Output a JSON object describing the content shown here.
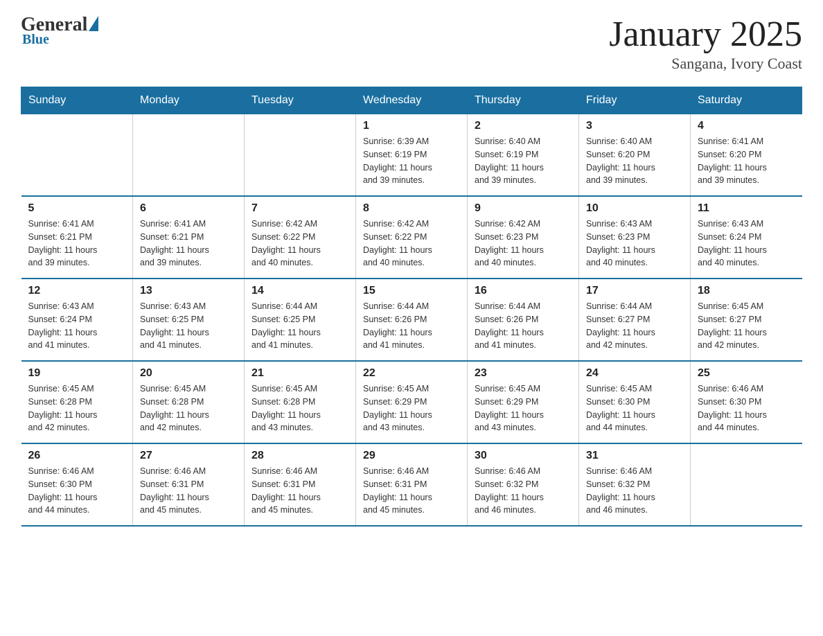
{
  "logo": {
    "general": "General",
    "blue": "Blue"
  },
  "title": "January 2025",
  "location": "Sangana, Ivory Coast",
  "days_header": [
    "Sunday",
    "Monday",
    "Tuesday",
    "Wednesday",
    "Thursday",
    "Friday",
    "Saturday"
  ],
  "weeks": [
    [
      {
        "day": "",
        "info": ""
      },
      {
        "day": "",
        "info": ""
      },
      {
        "day": "",
        "info": ""
      },
      {
        "day": "1",
        "info": "Sunrise: 6:39 AM\nSunset: 6:19 PM\nDaylight: 11 hours\nand 39 minutes."
      },
      {
        "day": "2",
        "info": "Sunrise: 6:40 AM\nSunset: 6:19 PM\nDaylight: 11 hours\nand 39 minutes."
      },
      {
        "day": "3",
        "info": "Sunrise: 6:40 AM\nSunset: 6:20 PM\nDaylight: 11 hours\nand 39 minutes."
      },
      {
        "day": "4",
        "info": "Sunrise: 6:41 AM\nSunset: 6:20 PM\nDaylight: 11 hours\nand 39 minutes."
      }
    ],
    [
      {
        "day": "5",
        "info": "Sunrise: 6:41 AM\nSunset: 6:21 PM\nDaylight: 11 hours\nand 39 minutes."
      },
      {
        "day": "6",
        "info": "Sunrise: 6:41 AM\nSunset: 6:21 PM\nDaylight: 11 hours\nand 39 minutes."
      },
      {
        "day": "7",
        "info": "Sunrise: 6:42 AM\nSunset: 6:22 PM\nDaylight: 11 hours\nand 40 minutes."
      },
      {
        "day": "8",
        "info": "Sunrise: 6:42 AM\nSunset: 6:22 PM\nDaylight: 11 hours\nand 40 minutes."
      },
      {
        "day": "9",
        "info": "Sunrise: 6:42 AM\nSunset: 6:23 PM\nDaylight: 11 hours\nand 40 minutes."
      },
      {
        "day": "10",
        "info": "Sunrise: 6:43 AM\nSunset: 6:23 PM\nDaylight: 11 hours\nand 40 minutes."
      },
      {
        "day": "11",
        "info": "Sunrise: 6:43 AM\nSunset: 6:24 PM\nDaylight: 11 hours\nand 40 minutes."
      }
    ],
    [
      {
        "day": "12",
        "info": "Sunrise: 6:43 AM\nSunset: 6:24 PM\nDaylight: 11 hours\nand 41 minutes."
      },
      {
        "day": "13",
        "info": "Sunrise: 6:43 AM\nSunset: 6:25 PM\nDaylight: 11 hours\nand 41 minutes."
      },
      {
        "day": "14",
        "info": "Sunrise: 6:44 AM\nSunset: 6:25 PM\nDaylight: 11 hours\nand 41 minutes."
      },
      {
        "day": "15",
        "info": "Sunrise: 6:44 AM\nSunset: 6:26 PM\nDaylight: 11 hours\nand 41 minutes."
      },
      {
        "day": "16",
        "info": "Sunrise: 6:44 AM\nSunset: 6:26 PM\nDaylight: 11 hours\nand 41 minutes."
      },
      {
        "day": "17",
        "info": "Sunrise: 6:44 AM\nSunset: 6:27 PM\nDaylight: 11 hours\nand 42 minutes."
      },
      {
        "day": "18",
        "info": "Sunrise: 6:45 AM\nSunset: 6:27 PM\nDaylight: 11 hours\nand 42 minutes."
      }
    ],
    [
      {
        "day": "19",
        "info": "Sunrise: 6:45 AM\nSunset: 6:28 PM\nDaylight: 11 hours\nand 42 minutes."
      },
      {
        "day": "20",
        "info": "Sunrise: 6:45 AM\nSunset: 6:28 PM\nDaylight: 11 hours\nand 42 minutes."
      },
      {
        "day": "21",
        "info": "Sunrise: 6:45 AM\nSunset: 6:28 PM\nDaylight: 11 hours\nand 43 minutes."
      },
      {
        "day": "22",
        "info": "Sunrise: 6:45 AM\nSunset: 6:29 PM\nDaylight: 11 hours\nand 43 minutes."
      },
      {
        "day": "23",
        "info": "Sunrise: 6:45 AM\nSunset: 6:29 PM\nDaylight: 11 hours\nand 43 minutes."
      },
      {
        "day": "24",
        "info": "Sunrise: 6:45 AM\nSunset: 6:30 PM\nDaylight: 11 hours\nand 44 minutes."
      },
      {
        "day": "25",
        "info": "Sunrise: 6:46 AM\nSunset: 6:30 PM\nDaylight: 11 hours\nand 44 minutes."
      }
    ],
    [
      {
        "day": "26",
        "info": "Sunrise: 6:46 AM\nSunset: 6:30 PM\nDaylight: 11 hours\nand 44 minutes."
      },
      {
        "day": "27",
        "info": "Sunrise: 6:46 AM\nSunset: 6:31 PM\nDaylight: 11 hours\nand 45 minutes."
      },
      {
        "day": "28",
        "info": "Sunrise: 6:46 AM\nSunset: 6:31 PM\nDaylight: 11 hours\nand 45 minutes."
      },
      {
        "day": "29",
        "info": "Sunrise: 6:46 AM\nSunset: 6:31 PM\nDaylight: 11 hours\nand 45 minutes."
      },
      {
        "day": "30",
        "info": "Sunrise: 6:46 AM\nSunset: 6:32 PM\nDaylight: 11 hours\nand 46 minutes."
      },
      {
        "day": "31",
        "info": "Sunrise: 6:46 AM\nSunset: 6:32 PM\nDaylight: 11 hours\nand 46 minutes."
      },
      {
        "day": "",
        "info": ""
      }
    ]
  ]
}
